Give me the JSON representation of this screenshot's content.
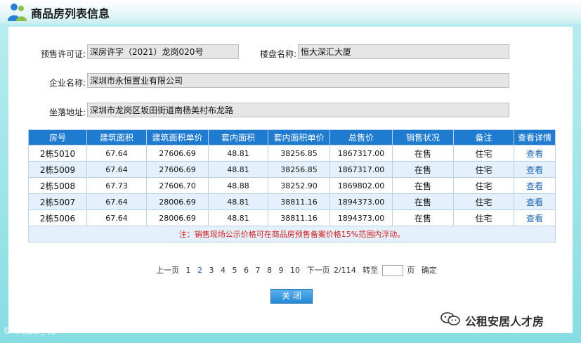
{
  "page_title": "商品房列表信息",
  "form": {
    "permit_label": "预售许可证:",
    "permit_value": "深房许字（2021）龙岗020号",
    "project_label": "楼盘名称:",
    "project_value": "恒大深汇大厦",
    "company_label": "企业名称:",
    "company_value": "深圳市永恒置业有限公司",
    "address_label": "坐落地址:",
    "address_value": "深圳市龙岗区坂田街道南杨美村布龙路"
  },
  "table": {
    "headers": [
      "房号",
      "建筑面积",
      "建筑面积单价",
      "套内面积",
      "套内面积单价",
      "总售价",
      "销售状况",
      "备注",
      "查看详情"
    ],
    "rows": [
      [
        "2栋5010",
        "67.64",
        "27606.69",
        "48.81",
        "38256.85",
        "1867317.00",
        "在售",
        "住宅",
        "查看"
      ],
      [
        "2栋5009",
        "67.64",
        "27606.69",
        "48.81",
        "38256.85",
        "1867317.00",
        "在售",
        "住宅",
        "查看"
      ],
      [
        "2栋5008",
        "67.73",
        "27606.70",
        "48.88",
        "38252.90",
        "1869802.00",
        "在售",
        "住宅",
        "查看"
      ],
      [
        "2栋5007",
        "67.64",
        "28006.69",
        "48.81",
        "38811.16",
        "1894373.00",
        "在售",
        "住宅",
        "查看"
      ],
      [
        "2栋5006",
        "67.64",
        "28006.69",
        "48.81",
        "38811.16",
        "1894373.00",
        "在售",
        "住宅",
        "查看"
      ]
    ],
    "note": "注：销售现场公示价格可在商品房预售备案价格15%范围内浮动。"
  },
  "pager": {
    "prev": "上一页",
    "pages": [
      "1",
      "2",
      "3",
      "4",
      "5",
      "6",
      "7",
      "8",
      "9",
      "10"
    ],
    "current": "2",
    "next": "下一页",
    "page_info": "2/114",
    "goto_label": "转至",
    "page_unit": "页",
    "confirm": "确定"
  },
  "close_button": "关闭",
  "watermark_right": "公租安居人才房",
  "watermark_left": "© 大数跨境",
  "colors": {
    "header_blue": "#1e7bd0",
    "frame_cyan": "#86dde3",
    "note_red": "#d21f1f",
    "link_blue": "#1a62b3"
  }
}
